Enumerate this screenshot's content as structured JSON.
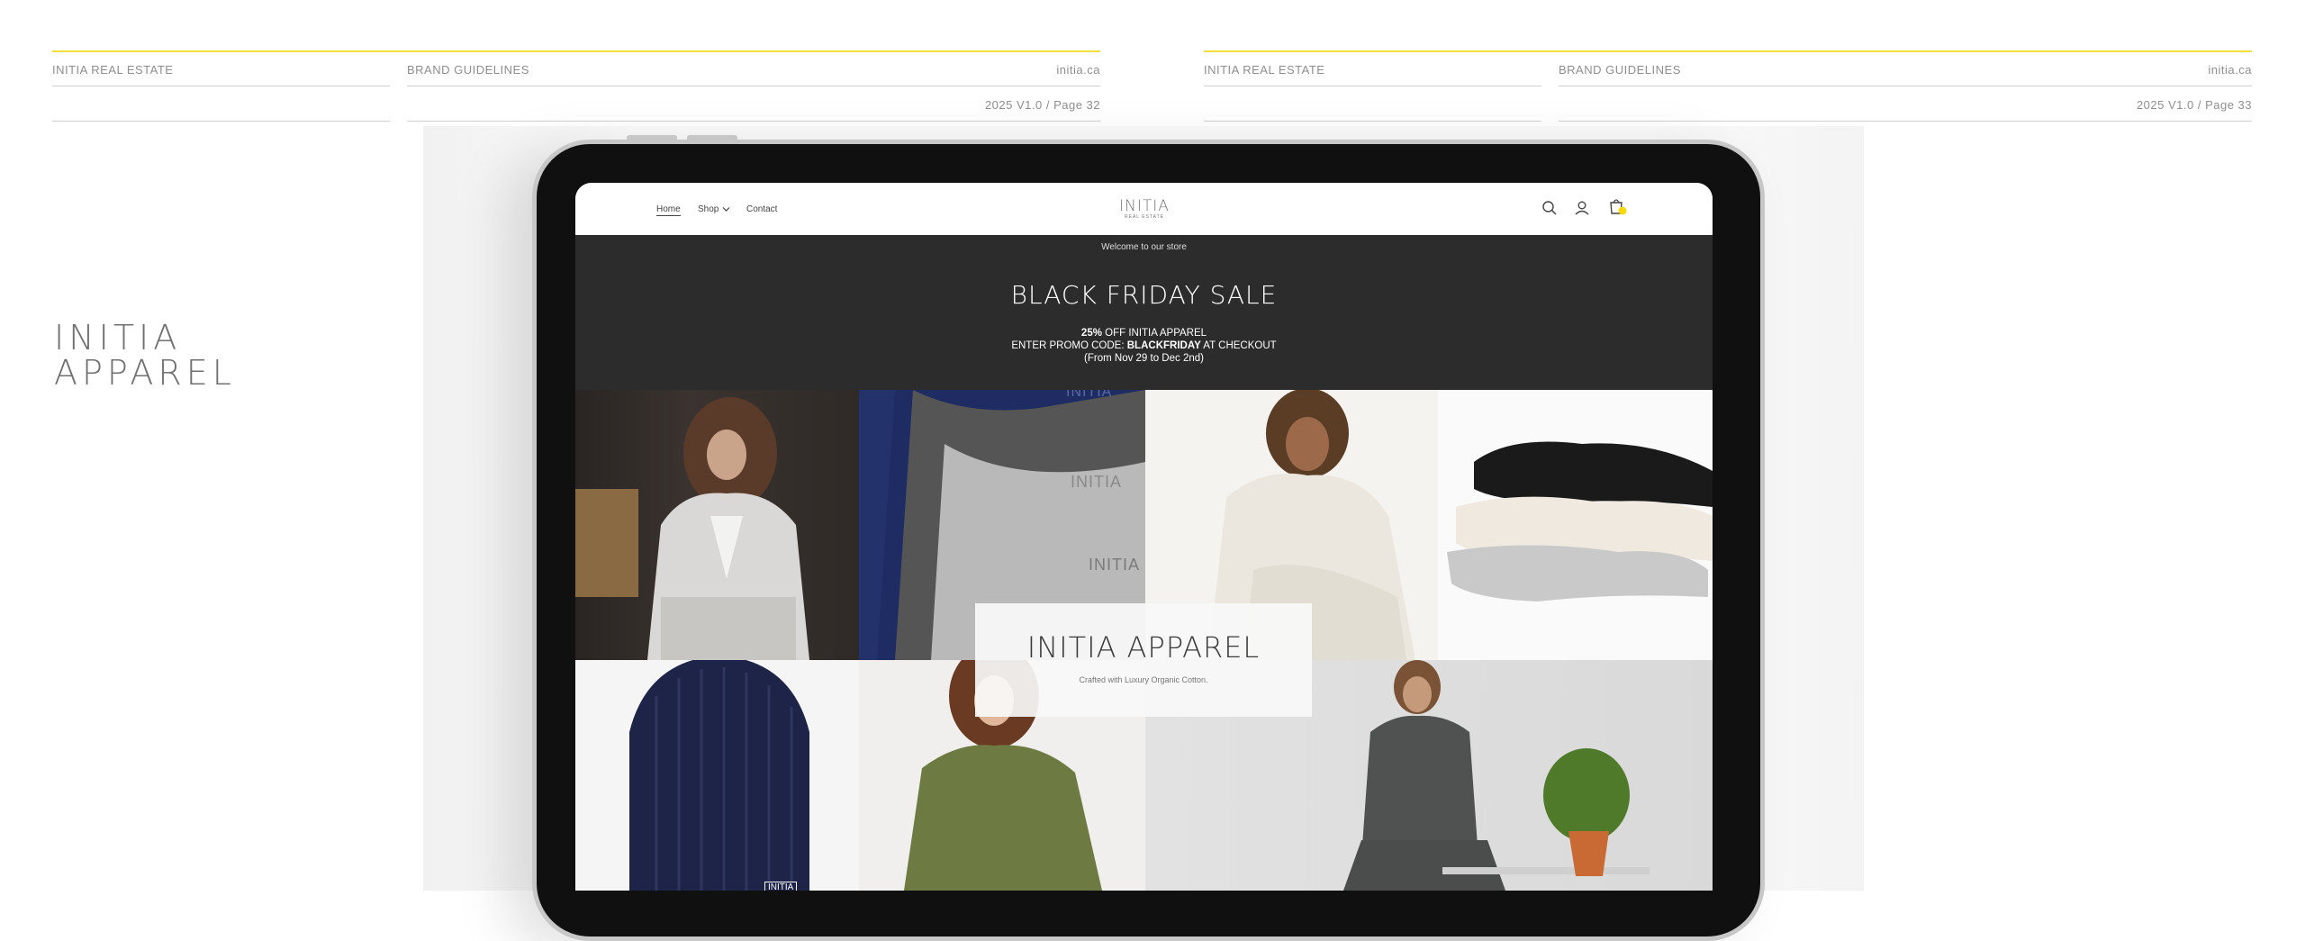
{
  "pages": [
    {
      "company": "INITIA REAL ESTATE",
      "section": "BRAND GUIDELINES",
      "site": "initia.ca",
      "version_page": "2025 V1.0 / Page 32"
    },
    {
      "company": "INITIA REAL ESTATE",
      "section": "BRAND GUIDELINES",
      "site": "initia.ca",
      "version_page": "2025 V1.0 / Page 33"
    }
  ],
  "title": {
    "line1": "INITIA",
    "line2": "APPAREL"
  },
  "store": {
    "nav": {
      "home": "Home",
      "shop": "Shop",
      "contact": "Contact"
    },
    "logo": {
      "main": "INITIA",
      "sub": "REAL ESTATE"
    },
    "icons": [
      "search-icon",
      "account-icon",
      "cart-icon"
    ],
    "accent_color": "#f5d90a",
    "banner": {
      "welcome": "Welcome to our store",
      "headline": "BLACK FRIDAY SALE",
      "offer_pct": "25%",
      "offer_rest": " OFF INITIA APPAREL",
      "promo_prefix": "ENTER PROMO CODE: ",
      "promo_code": "BLACKFRIDAY",
      "promo_suffix": " AT CHECKOUT",
      "dates": "(From Nov 29 to Dec 2nd)"
    },
    "hero": {
      "title": "INITIA APPAREL",
      "tagline": "Crafted with Luxury Organic Cotton."
    },
    "product_marks": {
      "sweater_1": "INITIA",
      "sweater_2": "INITIA",
      "sweater_3": "INITIA",
      "beanie_tag": "INITIA"
    }
  }
}
